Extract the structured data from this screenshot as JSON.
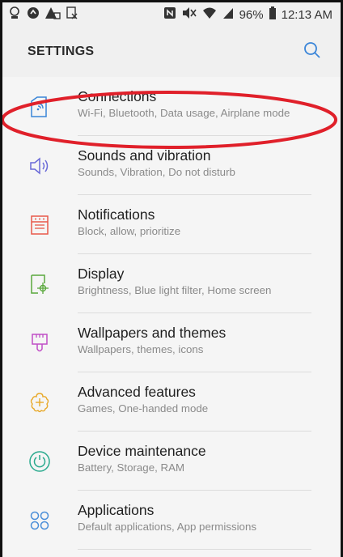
{
  "status_bar": {
    "battery_text": "96%",
    "time": "12:13 AM",
    "icons": [
      "usb-debug-icon",
      "data-saver-icon",
      "warning-icon",
      "screenshot-icon",
      "nfc-icon",
      "mute-icon",
      "wifi-icon",
      "signal-icon",
      "battery-icon"
    ]
  },
  "header": {
    "title": "SETTINGS",
    "search_icon": "search-icon"
  },
  "annotation": {
    "color": "#e0202a",
    "highlighted_item": "Connections"
  },
  "settings": [
    {
      "title": "Connections",
      "subtitle": "Wi-Fi, Bluetooth, Data usage, Airplane mode",
      "icon": "connections-icon",
      "color": "#3a85d8"
    },
    {
      "title": "Sounds and vibration",
      "subtitle": "Sounds, Vibration, Do not disturb",
      "icon": "speaker-icon",
      "color": "#6a6ad8"
    },
    {
      "title": "Notifications",
      "subtitle": "Block, allow, prioritize",
      "icon": "notifications-icon",
      "color": "#e8584a"
    },
    {
      "title": "Display",
      "subtitle": "Brightness, Blue light filter, Home screen",
      "icon": "display-icon",
      "color": "#5aa83c"
    },
    {
      "title": "Wallpapers and themes",
      "subtitle": "Wallpapers, themes, icons",
      "icon": "paintbrush-icon",
      "color": "#c04ec6"
    },
    {
      "title": "Advanced features",
      "subtitle": "Games, One-handed mode",
      "icon": "advanced-features-icon",
      "color": "#e8a92a"
    },
    {
      "title": "Device maintenance",
      "subtitle": "Battery, Storage, RAM",
      "icon": "device-maintenance-icon",
      "color": "#2aaa8e"
    },
    {
      "title": "Applications",
      "subtitle": "Default applications, App permissions",
      "icon": "applications-icon",
      "color": "#4a8ed8"
    }
  ]
}
